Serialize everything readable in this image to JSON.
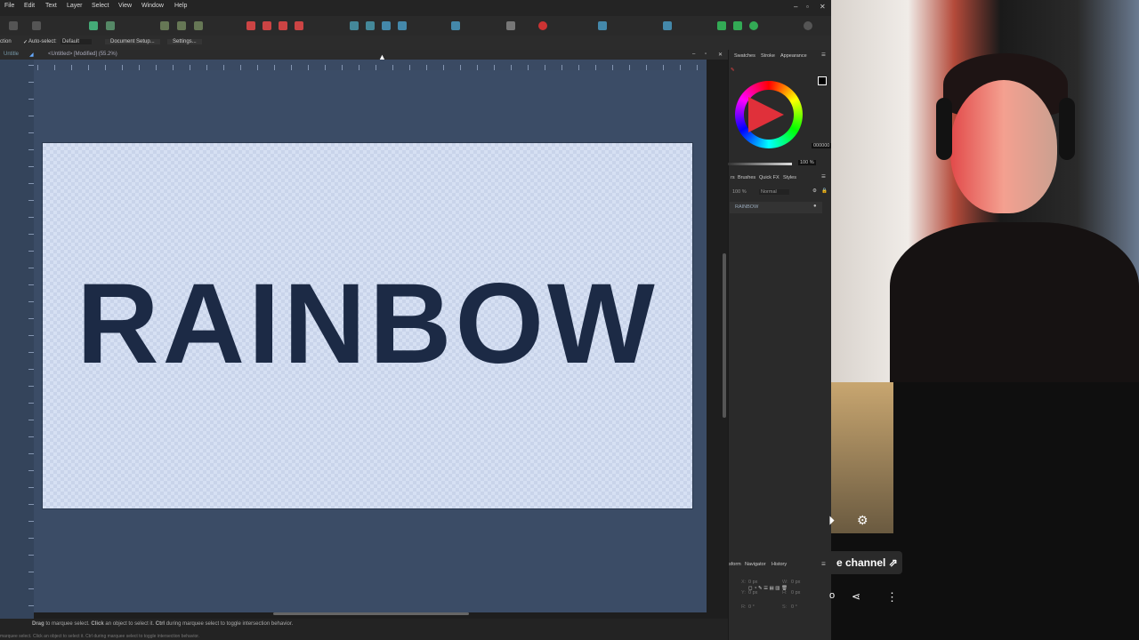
{
  "menu": [
    "File",
    "Edit",
    "Text",
    "Layer",
    "Select",
    "View",
    "Window",
    "Help"
  ],
  "context_bar": {
    "tool_label": "ction",
    "auto_select_label": "Auto-select:",
    "auto_select_value": "Default",
    "document_setup_label": "Document Setup...",
    "settings_label": "Settings..."
  },
  "tabs": {
    "active_short": "Untitle",
    "document_title": "<Untitled> [Modified] (55.2%)"
  },
  "canvas": {
    "artboard_text": "RAINBOW"
  },
  "status": {
    "line1_drag": "Drag",
    "line1_rest": "to marquee select.",
    "line1_click": "Click",
    "line1_rest2": "an object to select it.",
    "line1_ctrl": "Ctrl",
    "line1_rest3": "during marquee select to toggle intersection behavior.",
    "line2": "marquee select. Click an object to select it. Ctrl during marquee select to toggle intersection behavior."
  },
  "right_panel": {
    "top_tabs": [
      "Swatches",
      "Stroke",
      "Appearance"
    ],
    "hex_value": "000000",
    "opacity_value": "100 %",
    "layer_tabs": [
      "rs",
      "Brushes",
      "Quick FX",
      "Styles"
    ],
    "layer_opacity": "100 %",
    "blend_mode": "Normal",
    "layer_name": "RAINBOW",
    "bottom_tabs": [
      "sform",
      "Navigator",
      "History"
    ],
    "transform_fields": {
      "x": "0 px",
      "y": "0 px",
      "w": "0 px",
      "h": "0 px",
      "r": "0 °",
      "s": "0 °"
    }
  },
  "overlay": {
    "channel_button": "e channel"
  }
}
